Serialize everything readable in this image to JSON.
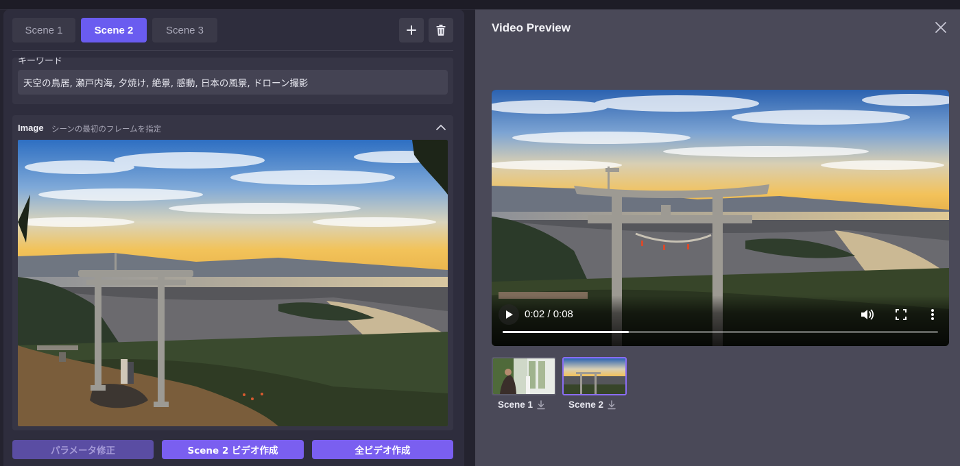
{
  "tabs": [
    {
      "label": "Scene 1",
      "active": false
    },
    {
      "label": "Scene 2",
      "active": true
    },
    {
      "label": "Scene 3",
      "active": false
    }
  ],
  "toolbar": {
    "add_icon": "plus-icon",
    "delete_icon": "trash-icon"
  },
  "keywords": {
    "label": "キーワード",
    "value": "天空の鳥居, 瀬戸内海, 夕焼け, 絶景, 感動, 日本の風景, ドローン撮影"
  },
  "image_section": {
    "title": "Image",
    "subtitle": "シーンの最初のフレームを指定",
    "collapse_icon": "chevron-up-icon"
  },
  "actions": {
    "param_edit": "パラメータ修正",
    "scene_video": "Scene 2 ビデオ作成",
    "all_video": "全ビデオ作成"
  },
  "preview": {
    "title": "Video Preview",
    "close_icon": "close-icon",
    "time": "0:02 / 0:08",
    "progress_fraction": 0.29
  },
  "thumbnails": [
    {
      "label": "Scene 1",
      "selected": false,
      "download_icon": "download-icon"
    },
    {
      "label": "Scene 2",
      "selected": true,
      "download_icon": "download-icon"
    }
  ],
  "colors": {
    "accent": "#6a5cf0",
    "button": "#7a5ff0",
    "panel_left": "#2e2d3d",
    "panel_right": "#4a4958"
  }
}
